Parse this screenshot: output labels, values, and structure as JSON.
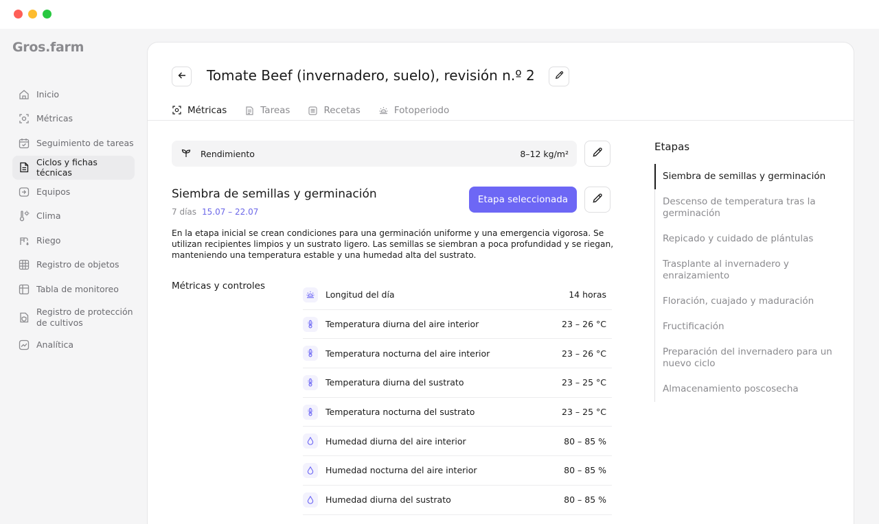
{
  "app": {
    "logo": "Gros.farm"
  },
  "sidebar": {
    "items": [
      {
        "label": "Inicio",
        "icon": "home-icon",
        "active": false
      },
      {
        "label": "Métricas",
        "icon": "metrics-icon",
        "active": false
      },
      {
        "label": "Seguimiento de tareas",
        "icon": "calendar-check-icon",
        "active": false
      },
      {
        "label": "Ciclos y fichas técnicas",
        "icon": "document-icon",
        "active": true
      },
      {
        "label": "Equipos",
        "icon": "equipment-icon",
        "active": false
      },
      {
        "label": "Clima",
        "icon": "climate-icon",
        "active": false
      },
      {
        "label": "Riego",
        "icon": "irrigation-icon",
        "active": false
      },
      {
        "label": "Registro de objetos",
        "icon": "grid-icon",
        "active": false
      },
      {
        "label": "Tabla de monitoreo",
        "icon": "table-icon",
        "active": false
      },
      {
        "label": "Registro de protección de cultivos",
        "icon": "shield-doc-icon",
        "active": false
      },
      {
        "label": "Analítica",
        "icon": "analytics-icon",
        "active": false
      }
    ]
  },
  "header": {
    "title": "Tomate Beef (invernadero, suelo), revisión n.º 2"
  },
  "tabs": [
    {
      "label": "Métricas",
      "icon": "metrics-icon",
      "active": true
    },
    {
      "label": "Tareas",
      "icon": "tasks-icon",
      "active": false
    },
    {
      "label": "Recetas",
      "icon": "recipes-icon",
      "active": false
    },
    {
      "label": "Fotoperiodo",
      "icon": "sun-icon",
      "active": false
    }
  ],
  "yield": {
    "label": "Rendimiento",
    "value": "8–12 kg/m²"
  },
  "stage": {
    "title": "Siembra de semillas y germinación",
    "duration": "7 días",
    "dates": "15.07 – 22.07",
    "selected_label": "Etapa seleccionada",
    "description": "En la etapa inicial se crean condiciones para una germinación uniforme y una emergencia vigorosa. Se utilizan recipientes limpios y un sustrato ligero. Las semillas se siembran a poca profundidad y se riegan, manteniendo una temperatura estable y una humedad alta del sustrato."
  },
  "metrics": {
    "heading": "Métricas y controles",
    "rows": [
      {
        "label": "Longitud del día",
        "value": "14 horas",
        "icon": "sun-icon"
      },
      {
        "label": "Temperatura diurna del aire interior",
        "value": "23 – 26 °C",
        "icon": "thermometer-icon"
      },
      {
        "label": "Temperatura nocturna del aire interior",
        "value": "23 – 26 °C",
        "icon": "thermometer-icon"
      },
      {
        "label": "Temperatura diurna del sustrato",
        "value": "23 – 25 °C",
        "icon": "thermometer-icon"
      },
      {
        "label": "Temperatura nocturna del sustrato",
        "value": "23 – 25 °C",
        "icon": "thermometer-icon"
      },
      {
        "label": "Humedad diurna del aire interior",
        "value": "80 – 85 %",
        "icon": "droplet-icon"
      },
      {
        "label": "Humedad nocturna del aire interior",
        "value": "80 – 85 %",
        "icon": "droplet-icon"
      },
      {
        "label": "Humedad diurna del sustrato",
        "value": "80 – 85 %",
        "icon": "droplet-icon"
      }
    ]
  },
  "stages": {
    "title": "Etapas",
    "items": [
      {
        "label": "Siembra de semillas y germinación",
        "active": true
      },
      {
        "label": "Descenso de temperatura tras la germinación",
        "active": false
      },
      {
        "label": "Repicado y cuidado de plántulas",
        "active": false
      },
      {
        "label": "Trasplante al invernadero y enraizamiento",
        "active": false
      },
      {
        "label": "Floración, cuajado y maduración",
        "active": false
      },
      {
        "label": "Fructificación",
        "active": false
      },
      {
        "label": "Preparación del invernadero para un nuevo ciclo",
        "active": false
      },
      {
        "label": "Almacenamiento poscosecha",
        "active": false
      }
    ]
  },
  "colors": {
    "accent": "#6d67f5",
    "dates": "#6b66e8",
    "muted": "#8a8a8e"
  }
}
